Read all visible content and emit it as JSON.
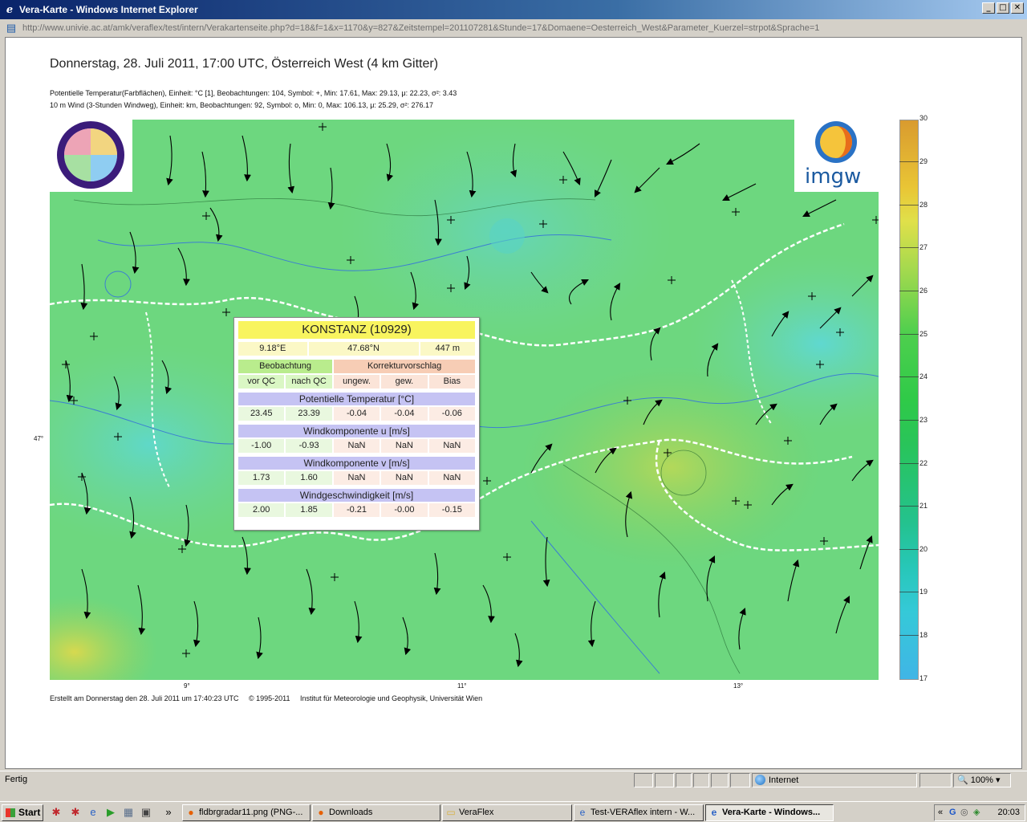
{
  "window": {
    "title": "Vera-Karte - Windows Internet Explorer",
    "address": "http://www.univie.ac.at/amk/veraflex/test/intern/Verakartenseite.php?d=18&f=1&x=1170&y=827&Zeitstempel=201107281&Stunde=17&Domaene=Oesterreich_West&Parameter_Kuerzel=strpot&Sprache=1"
  },
  "map": {
    "title": "Donnerstag, 28. Juli 2011, 17:00 UTC, Österreich West (4 km Gitter)",
    "info_line_1": "Potentielle Temperatur(Farbflächen), Einheit: °C [1], Beobachtungen: 104, Symbol: +, Min: 17.61, Max: 29.13,  μ: 22.23, σ²: 3.43",
    "info_line_2": "10 m Wind (3-Stunden Windweg), Einheit: km, Beobachtungen: 92, Symbol: o, Min: 0, Max: 106.13,  μ: 25.29, σ²: 276.17",
    "lat_label": "47°",
    "lon_labels": [
      "9°",
      "11°",
      "13°"
    ],
    "logo_text": "imgw",
    "colorbar_ticks": [
      "30",
      "29",
      "28",
      "27",
      "26",
      "25",
      "24",
      "23",
      "22",
      "21",
      "20",
      "19",
      "18",
      "17"
    ],
    "footer_created": "Erstellt am Donnerstag den 28. Juli 2011 um 17:40:23 UTC",
    "footer_copyright": "© 1995-2011",
    "footer_institute": "Institut für Meteorologie und Geophysik, Universität Wien"
  },
  "popup": {
    "station": "KONSTANZ (10929)",
    "lon": "9.18°E",
    "lat": "47.68°N",
    "alt": "447 m",
    "obs_header": "Beobachtung",
    "corr_header": "Korrekturvorschlag",
    "col_vor_qc": "vor QC",
    "col_nach_qc": "nach QC",
    "col_ungew": "ungew.",
    "col_gew": "gew.",
    "col_bias": "Bias",
    "sections": [
      {
        "title": "Potentielle Temperatur [°C]",
        "values": [
          "23.45",
          "23.39",
          "-0.04",
          "-0.04",
          "-0.06"
        ]
      },
      {
        "title": "Windkomponente u [m/s]",
        "values": [
          "-1.00",
          "-0.93",
          "NaN",
          "NaN",
          "NaN"
        ]
      },
      {
        "title": "Windkomponente v [m/s]",
        "values": [
          "1.73",
          "1.60",
          "NaN",
          "NaN",
          "NaN"
        ]
      },
      {
        "title": "Windgeschwindigkeit [m/s]",
        "values": [
          "2.00",
          "1.85",
          "-0.21",
          "-0.00",
          "-0.15"
        ]
      }
    ]
  },
  "status": {
    "text": "Fertig",
    "zone": "Internet",
    "zoom": "100%"
  },
  "taskbar": {
    "start": "Start",
    "tasks": [
      "fldbrgradar11.png (PNG-...",
      "Downloads",
      "VeraFlex",
      "Test-VERAflex intern - W...",
      "Vera-Karte - Windows..."
    ],
    "clock": "20:03"
  }
}
